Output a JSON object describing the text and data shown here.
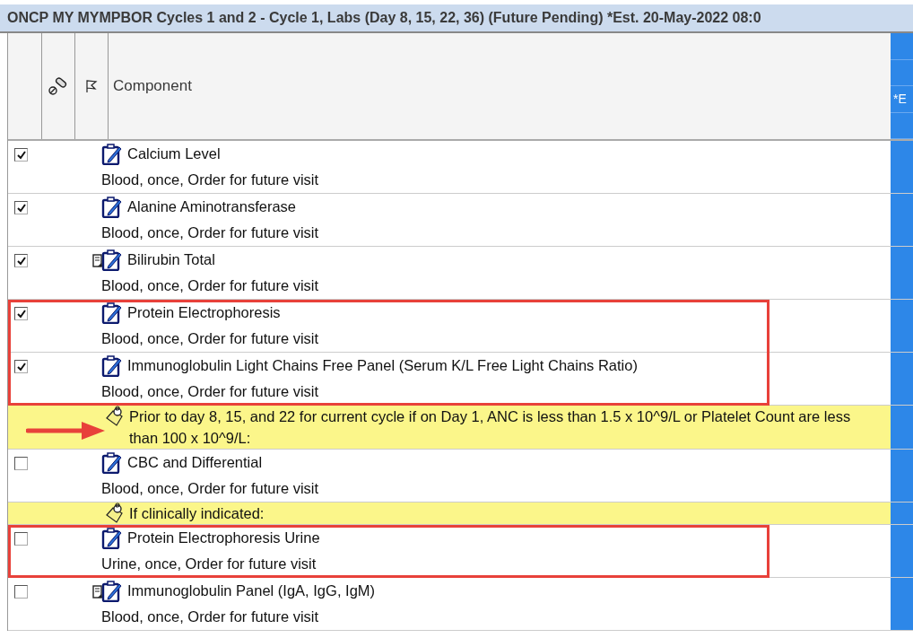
{
  "title": "ONCP MY MYMPBOR Cycles 1 and 2 - Cycle 1, Labs (Day 8, 15, 22, 36) (Future Pending) *Est. 20-May-2022 08:0",
  "header": {
    "component": "Component",
    "column_5": "*E"
  },
  "rows": [
    {
      "kind": "order",
      "checked": true,
      "doc_icon": false,
      "highlighted": false,
      "name": "Calcium Level",
      "detail": "Blood, once, Order for future visit"
    },
    {
      "kind": "order",
      "checked": true,
      "doc_icon": false,
      "highlighted": false,
      "name": "Alanine Aminotransferase",
      "detail": "Blood, once, Order for future visit"
    },
    {
      "kind": "order",
      "checked": true,
      "doc_icon": true,
      "highlighted": false,
      "name": "Bilirubin Total",
      "detail": "Blood, once, Order for future visit"
    },
    {
      "kind": "order",
      "checked": true,
      "doc_icon": false,
      "highlighted": true,
      "name": "Protein Electrophoresis",
      "detail": "Blood, once, Order for future visit"
    },
    {
      "kind": "order",
      "checked": true,
      "doc_icon": false,
      "highlighted": true,
      "name": "Immunoglobulin Light Chains Free Panel (Serum K/L Free Light Chains Ratio)",
      "detail": "Blood, once, Order for future visit"
    },
    {
      "kind": "note",
      "arrow": true,
      "text": "Prior to day 8, 15, and 22 for current cycle if on Day 1, ANC is less than 1.5 x 10^9/L or Platelet Count are less than 100 x 10^9/L:"
    },
    {
      "kind": "order",
      "checked": false,
      "doc_icon": false,
      "highlighted": false,
      "name": "CBC and Differential",
      "detail": "Blood, once, Order for future visit"
    },
    {
      "kind": "note",
      "arrow": false,
      "text": "If clinically indicated:"
    },
    {
      "kind": "order",
      "checked": false,
      "doc_icon": false,
      "highlighted": true,
      "name": "Protein Electrophoresis Urine",
      "detail": "Urine, once, Order for future visit"
    },
    {
      "kind": "order",
      "checked": false,
      "doc_icon": true,
      "highlighted": false,
      "name": "Immunoglobulin Panel (IgA, IgG, IgM)",
      "detail": "Blood, once, Order for future visit"
    }
  ]
}
